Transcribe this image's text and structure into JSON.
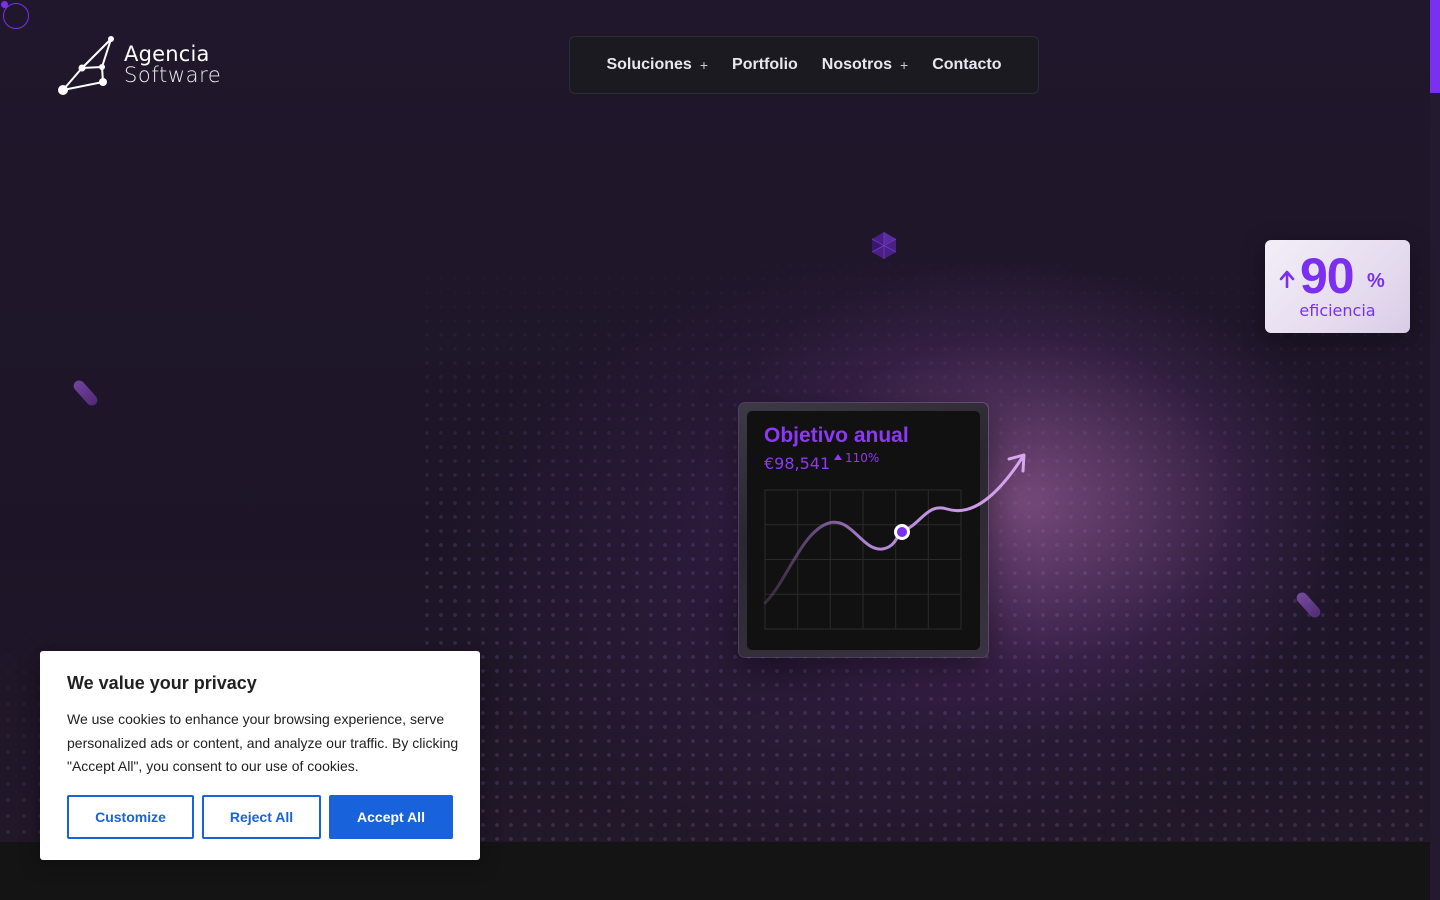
{
  "logo": {
    "line1": "Agencia",
    "line2": "Software"
  },
  "nav": {
    "items": [
      {
        "label": "Soluciones",
        "expand": "+"
      },
      {
        "label": "Portfolio"
      },
      {
        "label": "Nosotros",
        "expand": "+"
      },
      {
        "label": "Contacto"
      }
    ]
  },
  "efficiency": {
    "value": "90",
    "unit": "%",
    "label": "eficiencia"
  },
  "goal_card": {
    "title": "Objetivo anual",
    "amount": "€98,541",
    "change": "110%"
  },
  "cookie": {
    "title": "We value your privacy",
    "text": "We use cookies to enhance your browsing experience, serve personalized ads or content, and analyze our traffic. By clicking \"Accept All\", you consent to our use of cookies.",
    "customize": "Customize",
    "reject": "Reject All",
    "accept": "Accept All"
  },
  "colors": {
    "accent": "#7b2ff0",
    "cookie_button": "#1863dc",
    "background": "#1f1629"
  }
}
